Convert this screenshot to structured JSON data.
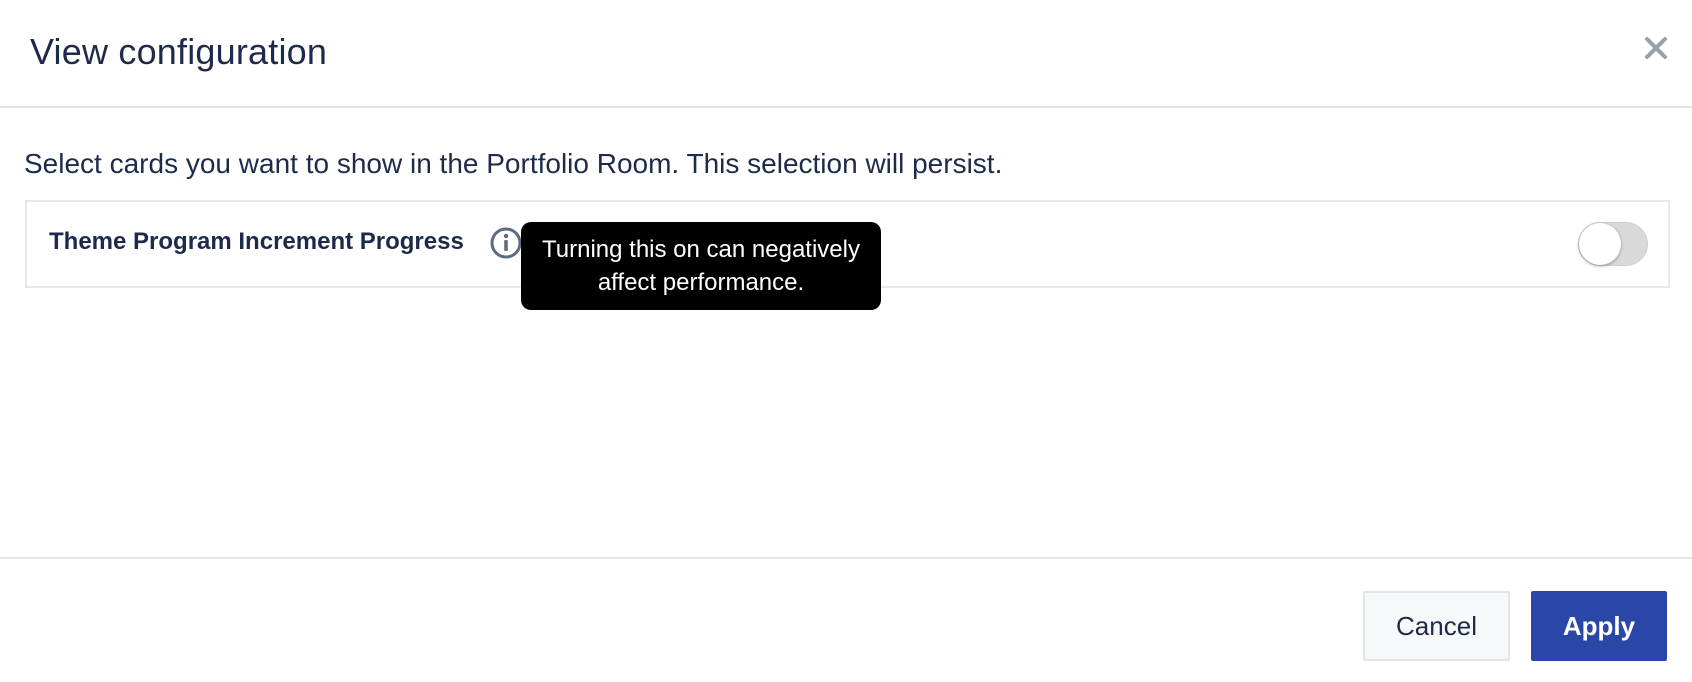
{
  "dialog": {
    "title": "View configuration",
    "close_icon": "close-icon"
  },
  "body": {
    "description": "Select cards you want to show in the Portfolio Room. This selection will persist.",
    "cards": [
      {
        "label": "Theme Program Increment Progress",
        "info_icon": "info-icon",
        "tooltip_line1": "Turning this on can negatively",
        "tooltip_line2": "affect performance.",
        "enabled": false
      }
    ]
  },
  "footer": {
    "cancel_label": "Cancel",
    "apply_label": "Apply"
  },
  "colors": {
    "title_text": "#1d2a4a",
    "apply_button": "#2a47a8",
    "tooltip_bg": "#000000",
    "toggle_off": "#d9d9d9",
    "divider": "#e3e5e8"
  }
}
